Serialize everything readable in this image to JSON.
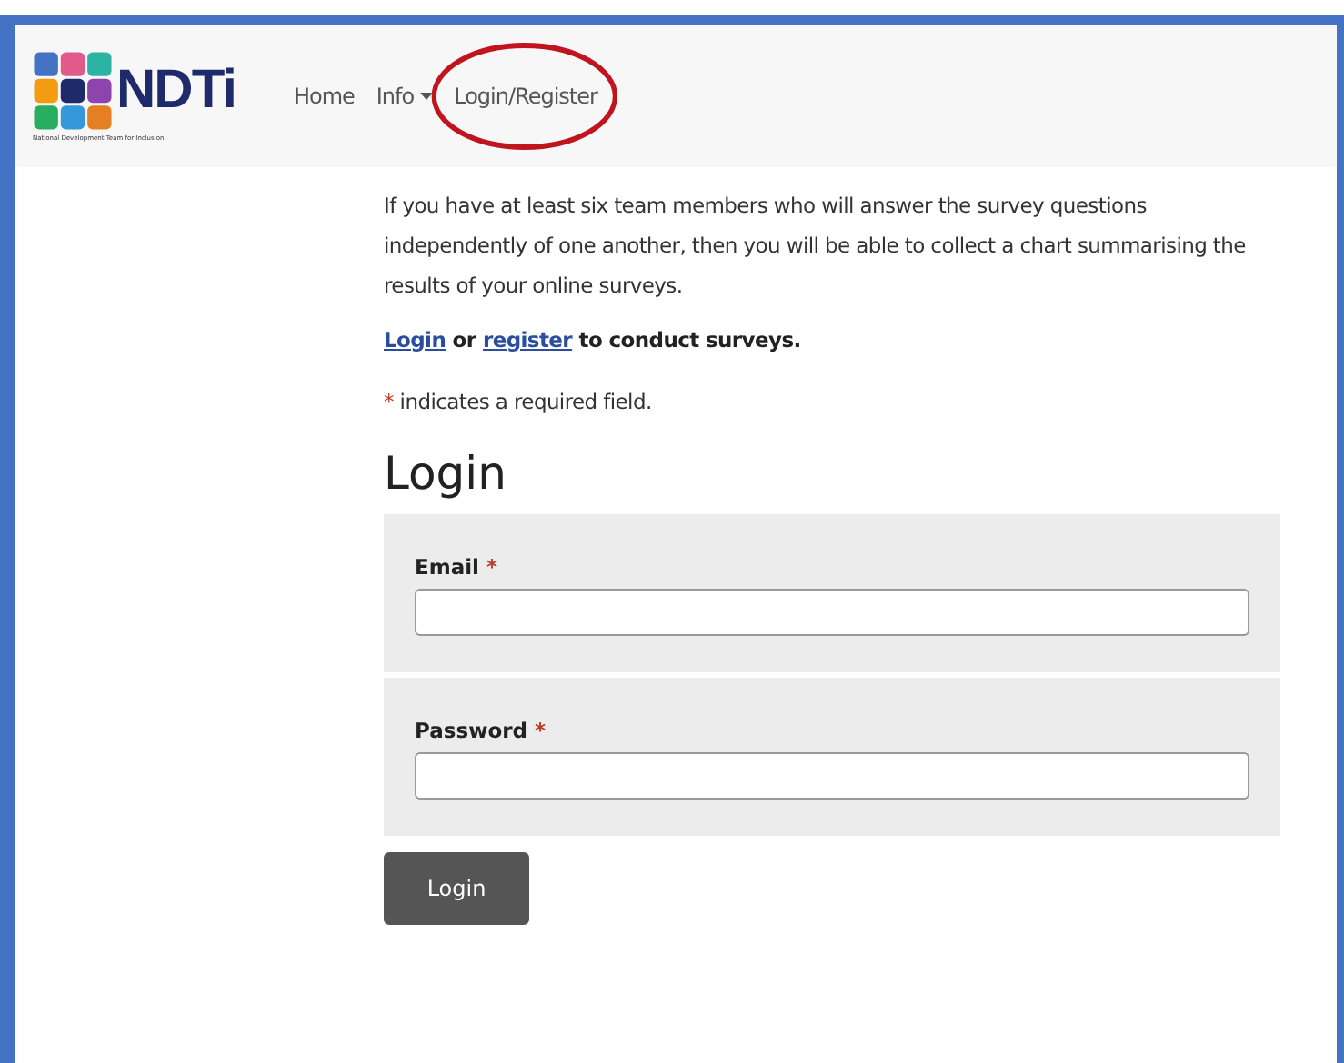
{
  "brand": {
    "name": "NDTi",
    "tagline": "National Development Team for Inclusion"
  },
  "nav": [
    {
      "label": "Home",
      "kind": "link",
      "highlighted": false
    },
    {
      "label": "Info",
      "kind": "dropdown",
      "highlighted": false
    },
    {
      "label": "Login/Register",
      "kind": "link",
      "highlighted": true
    }
  ],
  "intro": "If you have at least six team members who will answer the survey questions independently of one another, then you will be able to collect a chart summarising the results of your online surveys.",
  "prompt": [
    {
      "text": "Login",
      "kind": "link"
    },
    {
      "text": " or ",
      "kind": "text"
    },
    {
      "text": "register",
      "kind": "link"
    },
    {
      "text": " to conduct surveys.",
      "kind": "text"
    }
  ],
  "required_note": {
    "mark": "*",
    "text": " indicates a required field."
  },
  "form": {
    "title": "Login",
    "fields": [
      {
        "label": "Email",
        "required": true
      },
      {
        "label": "Password",
        "required": true
      }
    ],
    "submit": "Login"
  }
}
